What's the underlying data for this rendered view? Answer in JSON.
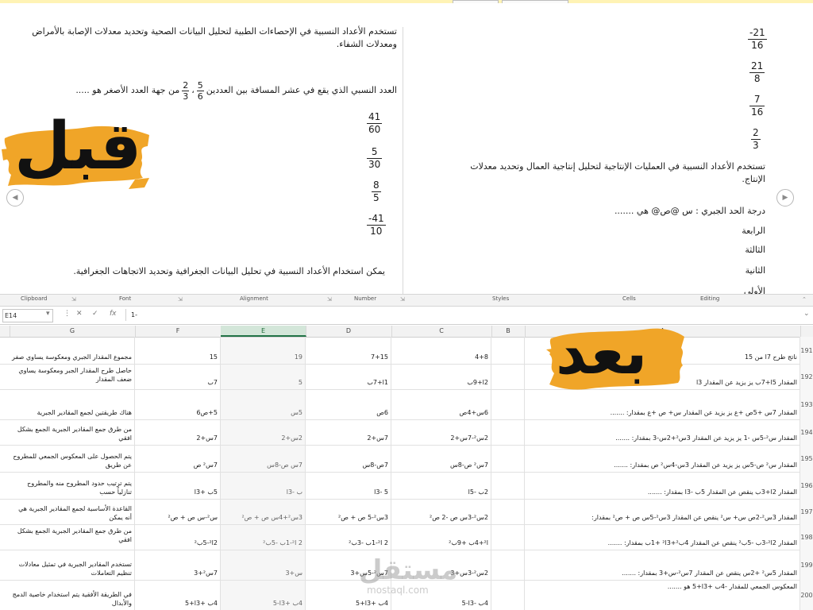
{
  "document": {
    "left_page": {
      "intro_text": "تستخدم الأعداد النسبية في الإحصاءات الطبية لتحليل البيانات الصحية وتحديد معدلات الإصابة بالأمراض ومعدلات الشفاء.",
      "question_prefix": "العدد النسبي الذي يقع في عشر المسافة بين العددين",
      "question_suffix": "من جهة العدد الأصغر هو .....",
      "q_frac1": {
        "num": "5",
        "den": "6"
      },
      "q_frac2": {
        "num": "2",
        "den": "3"
      },
      "q_separator": "،",
      "options": [
        {
          "num": "41",
          "den": "60"
        },
        {
          "num": "5",
          "den": "30"
        },
        {
          "num": "8",
          "den": "5"
        },
        {
          "num": "-41",
          "den": "10"
        }
      ],
      "footer_text": "يمكن استخدام الأعداد النسبية في تحليل البيانات الجغرافية وتحديد الاتجاهات الجغرافية."
    },
    "right_page": {
      "fractions": [
        {
          "num": "-21",
          "den": "16"
        },
        {
          "num": "21",
          "den": "8"
        },
        {
          "num": "7",
          "den": "16"
        },
        {
          "num": "2",
          "den": "3"
        }
      ],
      "statement": "تستخدم الأعداد النسبية في العمليات الإنتاجية لتحليل إنتاجية العمال وتحديد معدلات الإنتاج.",
      "question": "درجة الحد الجبري : س @ص@   هي   .......",
      "options": [
        "الرابعة",
        "الثالثة",
        "الثانية",
        "الأولى"
      ]
    },
    "labels": {
      "before": "قبل",
      "after": "بعد"
    },
    "nav": {
      "prev_icon": "◀",
      "next_icon": "▶"
    }
  },
  "ribbon": {
    "groups": [
      "Clipboard",
      "Font",
      "Alignment",
      "Number",
      "Styles",
      "Cells",
      "Editing"
    ]
  },
  "formula_bar": {
    "cell_ref": "E14",
    "cancel_icon": "✕",
    "enter_icon": "✓",
    "fx": "fx",
    "content": "1-"
  },
  "columns": [
    "G",
    "F",
    "E",
    "D",
    "C",
    "B",
    "A"
  ],
  "rows": [
    {
      "num": "191",
      "a": "ناتج طرح 7ا من 15",
      "c": "4+8",
      "d": "7+15",
      "e": "19",
      "f": "15",
      "g": "مجموع المقدار الجبري ومعكوسة يساوي صفر"
    },
    {
      "num": "192",
      "a": "المقدار 5ا+7ب يز يزيد عن المقدار 3ا",
      "c": "2ا+9ب",
      "d": "1ا+7ب",
      "e": "5",
      "f": "7ب",
      "g": "حاصل طرح المقدار الجبر ومعكوسة يساوي ضعف المقدار"
    },
    {
      "num": "193",
      "a": "المقدار 7س +5ص +ع يز يزيد عن المقدار س+ ص +ع بمقدار: .......",
      "c": "6س+4ص",
      "d": "6ص",
      "e": "5س",
      "f": "5+ص6",
      "g": "هناك طريقتين لجمع المقادير الجبرية"
    },
    {
      "num": "194",
      "a": "المقدار س²-5س -1 يز يزيد عن المقدار 3س²+2س-3 بمقدار: .......",
      "c": "2س²-7س+2",
      "d": "7س+2",
      "e": "2س+2",
      "f": "7س+2",
      "g": "من طرق جمع المقادير الجبرية الجمع بشكل افقي"
    },
    {
      "num": "195",
      "a": "المقدار س² ص-5س يز يزيد عن المقدار 3س-4س² ص بمقدار: .......",
      "c": "7س² ص-8س",
      "d": "7ص-8س",
      "e": "7س ص-8س",
      "f": "7س² ص",
      "g": "يتم الحصول على المعكوس الجمعي للمطروح عن طريق"
    },
    {
      "num": "196",
      "a": "المقدار 2ا+3ب ينقص عن المقدار 5ب -3ا بمقدار: .......",
      "c": "2ب -5ا",
      "d": "5 -3ا",
      "e": "ب -3ا",
      "f": "5ب +3ا",
      "g": "يتم ترتيب حدود المطروح منه والمطروح تنازلياً حسب"
    },
    {
      "num": "197",
      "a": "المقدار 3س²-2ص س+ س² ينقص عن المقدار 3س²-5س ص + ص² بمقدار:",
      "c": "2س²-3س ص -2 ص²",
      "d": "3س²-5 ص + ص²",
      "e": "3س²+4س ص + ص²",
      "f": "س²-س ص + ص²",
      "g": "القاعدة الأساسية لجمع المقادير الجبرية هي أنه يمكن"
    },
    {
      "num": "198",
      "a": "المقدار 2ا²-3ب -5ب² ينقص عن المقدار 4ب²+3ا² +1ب بمقدار: .......",
      "c": "ا²+4ب +9ب²",
      "d": "2 ا²-1ب -3ب²",
      "e": "2 ا²-1ب -5ب²",
      "f": "2ا²-5ب²",
      "g": "من طرق جمع المقادير الجبرية الجمع بشكل افقي"
    },
    {
      "num": "199",
      "a": "المقدار 5س² +2س ينقص عن المقدار 7س²-س+3 بمقدار: .......",
      "c": "2س²-3س+3",
      "d": "7س²-5س+3",
      "e": "س+3",
      "f": "7س²+3",
      "g": "تستخدم المقادير الجبرية في تمثيل معادلات تنظيم التعاملات"
    },
    {
      "num": "200",
      "a": "المعكوس الجمعي للمقدار -4ب +3ا+5 هو .......",
      "c": "4ب -3ا-5",
      "d": "4ب +3ا+5",
      "e": "4ب +3ا-5",
      "f": "4ب +3ا+5",
      "g": "في الطريقة الأفقية يتم استخدام خاصية الدمج والأبدال"
    }
  ],
  "watermark": {
    "text": "مستقل",
    "sub": "mostaql.com"
  },
  "colors": {
    "brush": "#f0a528",
    "accent": "#217346"
  }
}
